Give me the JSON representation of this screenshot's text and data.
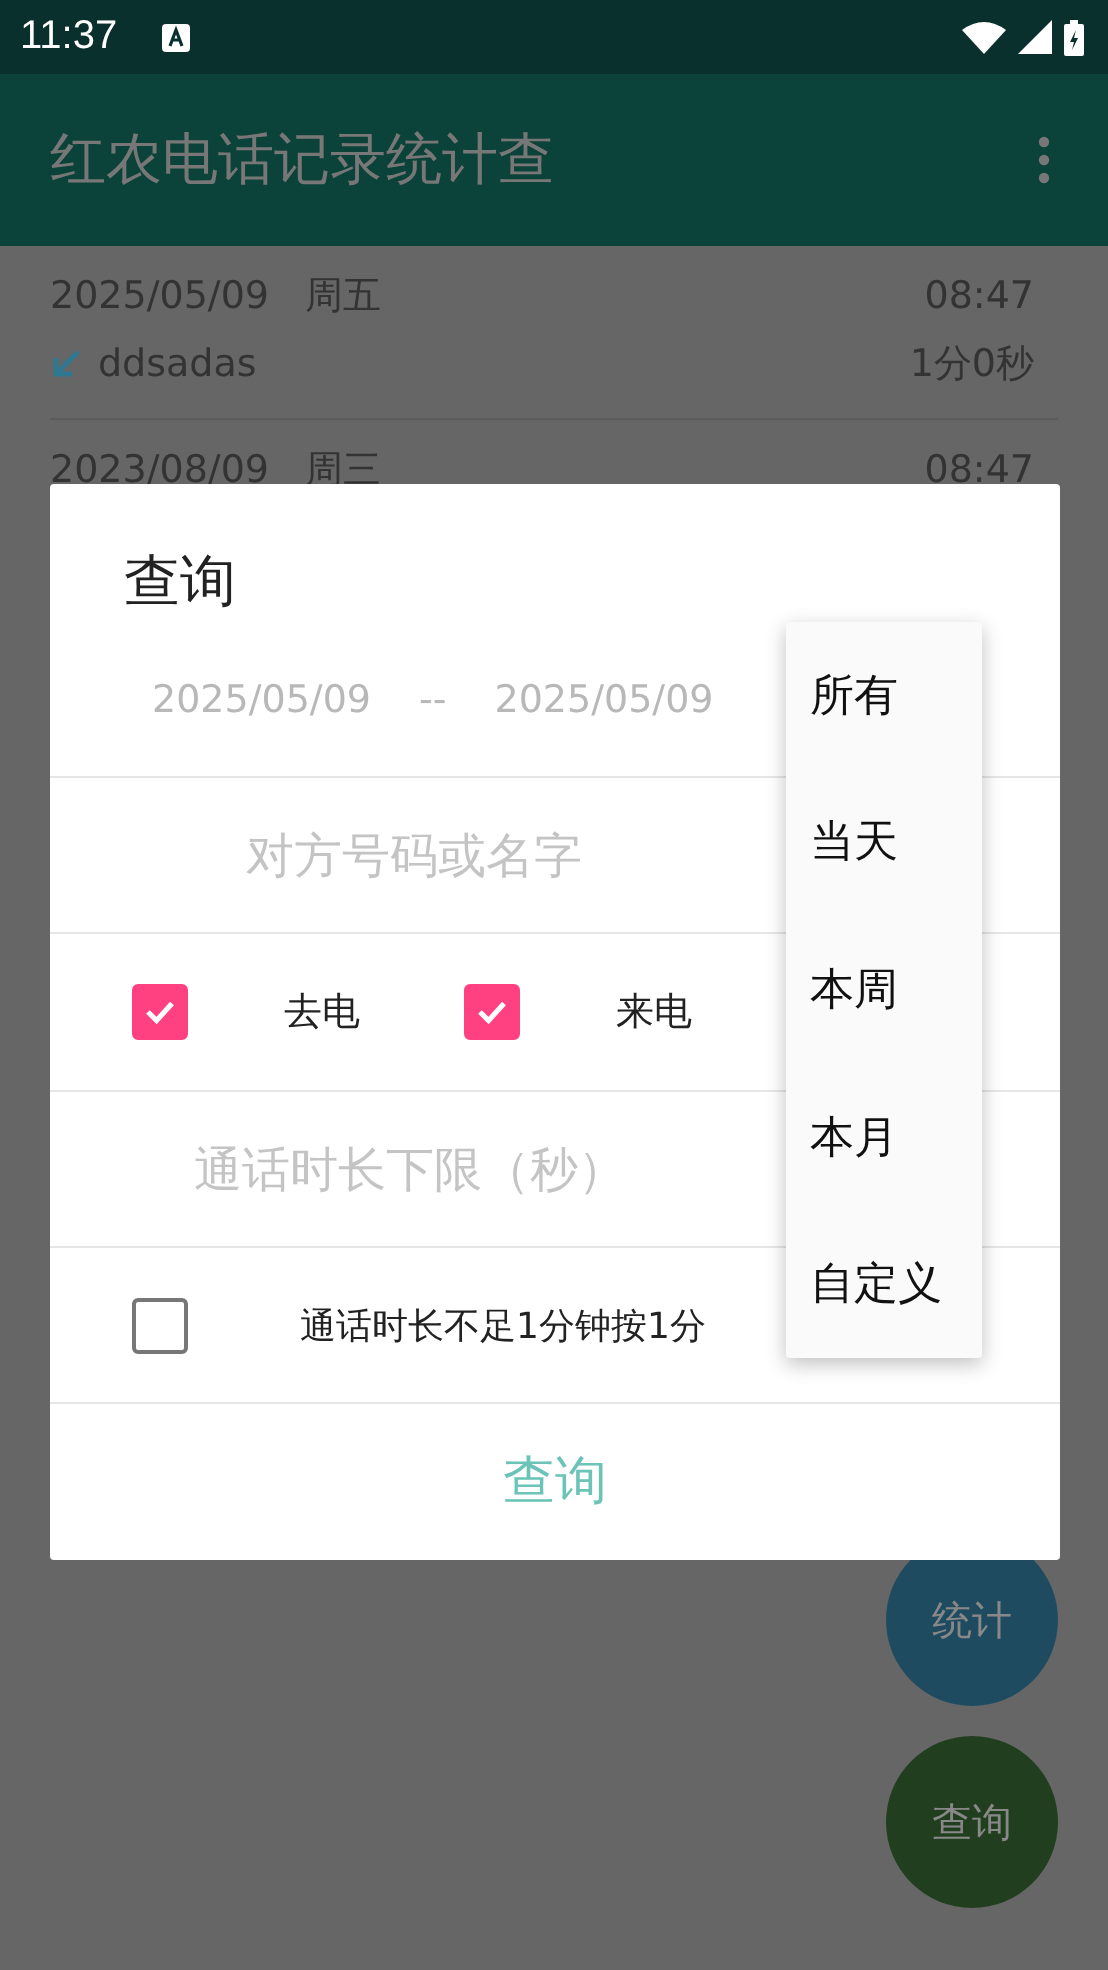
{
  "status_bar": {
    "time": "11:37"
  },
  "app_bar": {
    "title": "红农电话记录统计查"
  },
  "call_log": [
    {
      "date": "2025/05/09",
      "weekday": "周五",
      "time": "08:47",
      "name": "ddsadas",
      "duration": "1分0秒"
    },
    {
      "date": "2023/08/09",
      "weekday": "周三",
      "time": "08:47"
    }
  ],
  "dialog": {
    "title": "查询",
    "date_from": "2025/05/09",
    "date_separator": "--",
    "date_to": "2025/05/09",
    "name_field": {
      "placeholder": "对方号码或名字"
    },
    "call_types": [
      {
        "label": "去电",
        "checked": true
      },
      {
        "label": "来电",
        "checked": true
      }
    ],
    "min_duration_field": {
      "placeholder": "通话时长下限（秒）"
    },
    "round_up": {
      "label": "通话时长不足1分钟按1分",
      "checked": false
    },
    "submit_button": "查询"
  },
  "dropdown_menu": {
    "items": [
      {
        "label": "所有"
      },
      {
        "label": "当天"
      },
      {
        "label": "本周"
      },
      {
        "label": "本月"
      },
      {
        "label": "自定义"
      }
    ]
  },
  "fabs": [
    {
      "label": "统计",
      "color": "#1f4b60"
    },
    {
      "label": "查询",
      "color": "#213f1f"
    }
  ]
}
